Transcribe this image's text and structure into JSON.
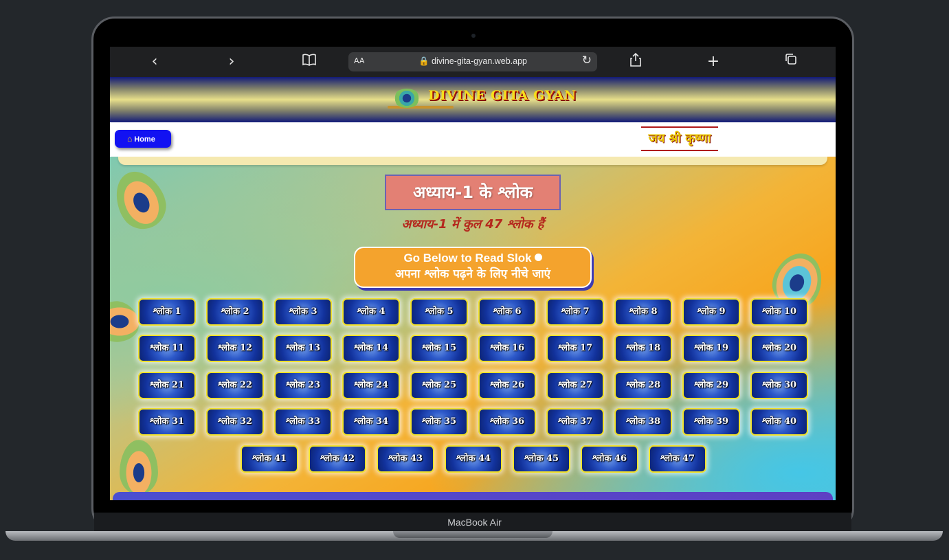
{
  "device": {
    "label": "MacBook Air"
  },
  "browser": {
    "text_size_label": "AA",
    "url": "divine-gita-gyan.web.app",
    "icons": {
      "back": "chevron-left-icon",
      "forward": "chevron-right-icon",
      "bookmarks": "book-icon",
      "reload": "reload-icon",
      "share": "share-icon",
      "new_tab": "plus-icon",
      "tabs": "tabs-icon",
      "lock": "lock-icon"
    }
  },
  "site": {
    "brand": "DIVINE GITA GYAN",
    "nav": {
      "home_label": "Home",
      "greeting": "जय श्री कृष्णा"
    }
  },
  "chapter": {
    "title": "अध्याय-1 के श्लोक",
    "subtitle": "अध्याय-1 में कुल 47 श्लोक हैं",
    "go_below_en": "Go Below to Read Slok",
    "go_below_hi": "अपना श्लोक पढ़ने के लिए नीचे जाएं"
  },
  "slokas": [
    "श्लोक 1",
    "श्लोक 2",
    "श्लोक 3",
    "श्लोक 4",
    "श्लोक 5",
    "श्लोक 6",
    "श्लोक 7",
    "श्लोक 8",
    "श्लोक 9",
    "श्लोक 10",
    "श्लोक 11",
    "श्लोक 12",
    "श्लोक 13",
    "श्लोक 14",
    "श्लोक 15",
    "श्लोक 16",
    "श्लोक 17",
    "श्लोक 18",
    "श्लोक 19",
    "श्लोक 20",
    "श्लोक 21",
    "श्लोक 22",
    "श्लोक 23",
    "श्लोक 24",
    "श्लोक 25",
    "श्लोक 26",
    "श्लोक 27",
    "श्लोक 28",
    "श्लोक 29",
    "श्लोक 30",
    "श्लोक 31",
    "श्लोक 32",
    "श्लोक 33",
    "श्लोक 34",
    "श्लोक 35",
    "श्लोक 36",
    "श्लोक 37",
    "श्लोक 38",
    "श्लोक 39",
    "श्लोक 40",
    "श्लोक 41",
    "श्लोक 42",
    "श्लोक 43",
    "श्लोक 44",
    "श्लोक 45",
    "श्लोक 46",
    "श्लोक 47"
  ],
  "colors": {
    "brand_yellow": "#f5df1c",
    "home_button": "#1212f2",
    "title_box": "#e38074",
    "subtitle_red": "#b5271d",
    "go_button": "#f4a32d",
    "sloka_border": "#f2e22b"
  }
}
